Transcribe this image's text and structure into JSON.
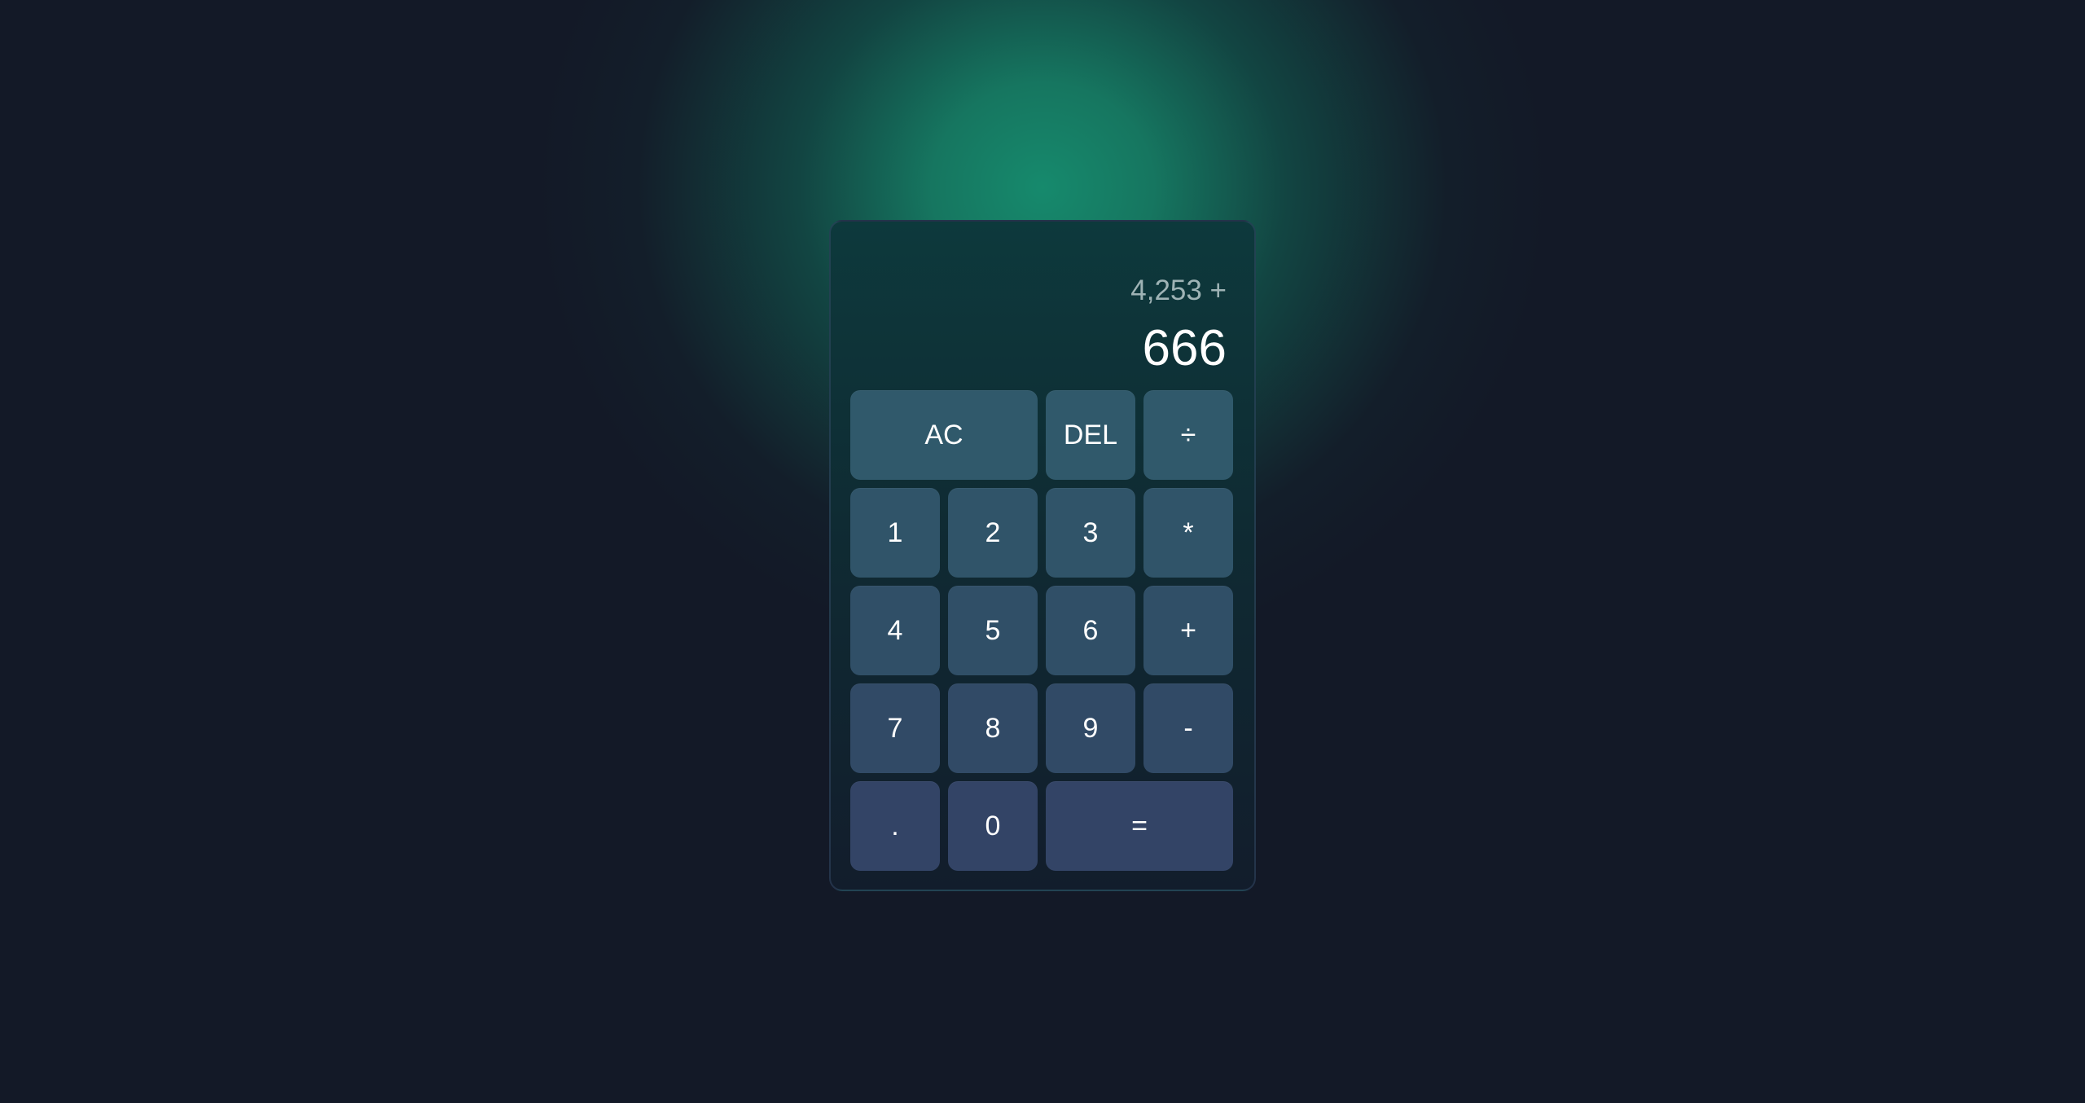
{
  "display": {
    "previous": "4,253 +",
    "current": "666"
  },
  "keys": {
    "clear": "AC",
    "delete": "DEL",
    "divide": "÷",
    "one": "1",
    "two": "2",
    "three": "3",
    "multiply": "*",
    "four": "4",
    "five": "5",
    "six": "6",
    "add": "+",
    "seven": "7",
    "eight": "8",
    "nine": "9",
    "subtract": "-",
    "decimal": ".",
    "zero": "0",
    "equals": "="
  },
  "colors": {
    "background": "#131927",
    "glow": "#168c6e",
    "key": "#30546b",
    "text": "#ffffff",
    "previous_text": "#9fb3b5"
  }
}
